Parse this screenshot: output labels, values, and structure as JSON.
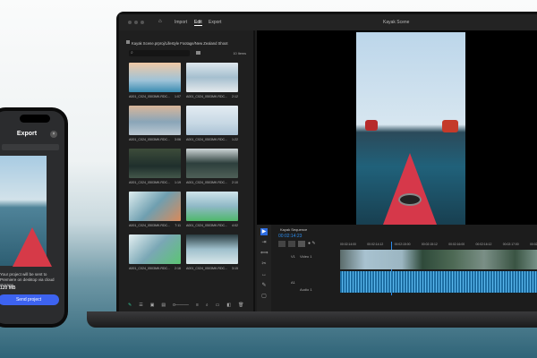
{
  "app": {
    "nav": [
      "Import",
      "Edit",
      "Export"
    ],
    "active_tab": "Edit",
    "window_title": "Kayak Scene"
  },
  "project": {
    "path": "Kayak Scene.prproj/Lifestyle Footage/New Zealand Shoot",
    "item_count": "10 Items",
    "clips": [
      {
        "name": "A001_C024_0503MK.RDC...",
        "duration": "1:07"
      },
      {
        "name": "A001_C024_0503MK.RDC...",
        "duration": "2:12"
      },
      {
        "name": "A001_C024_0503MK.RDC...",
        "duration": "3:06"
      },
      {
        "name": "A001_C024_0503MK.RDC...",
        "duration": "1:22"
      },
      {
        "name": "A001_C024_0503MK.RDC...",
        "duration": "1:19"
      },
      {
        "name": "A001_C024_0503MK.RDC...",
        "duration": "2:10"
      },
      {
        "name": "A001_C024_0503MK.RDC...",
        "duration": "7:11"
      },
      {
        "name": "A001_C024_0503MK.RDC...",
        "duration": "4:02"
      },
      {
        "name": "A001_C024_0503MK.RDC...",
        "duration": "2:16"
      },
      {
        "name": "A001_C024_0503MK.RDC...",
        "duration": "3:15"
      }
    ]
  },
  "timeline": {
    "sequence": "Kayak Sequence",
    "timecode": "00:02:14:23",
    "ruler": [
      "00:02:14:00",
      "00:02:14:12",
      "00:02:15:00",
      "00:02:15:12",
      "00:02:16:00",
      "00:02:16:12",
      "00:02:17:00",
      "00:02:17:12"
    ],
    "tracks": {
      "video": "Video 1",
      "video_id": "V1",
      "audio": "Audio 1",
      "audio_id": "A1"
    }
  },
  "phone": {
    "title": "Export",
    "message": "Your project will be sent to Premiere on desktop via cloud storage",
    "size": "120 MB",
    "send_label": "Send project"
  },
  "colors": {
    "accent": "#2d8ceb",
    "send": "#3d63f0",
    "audio": "#1d6ea3"
  }
}
